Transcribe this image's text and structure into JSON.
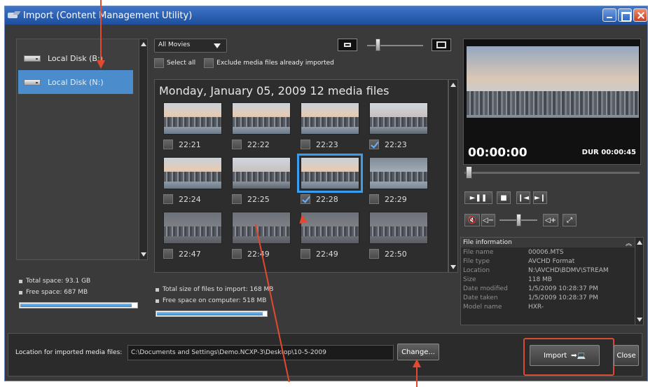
{
  "window": {
    "title": "Import (Content Management Utility)"
  },
  "disks": [
    {
      "label": "Local Disk (B:)"
    },
    {
      "label": "Local Disk (N:)"
    }
  ],
  "left_stats": {
    "total": "Total space: 93.1 GB",
    "free": "Free space: 687 MB",
    "free_fraction": 0.96
  },
  "toolbar": {
    "filter": "All Movies",
    "select_all": "Select all",
    "exclude": "Exclude media files already imported"
  },
  "gallery": {
    "date_header": "Monday, January 05, 2009 12 media files",
    "items": [
      {
        "time": "22:21",
        "checked": false
      },
      {
        "time": "22:22",
        "checked": false
      },
      {
        "time": "22:23",
        "checked": false
      },
      {
        "time": "22:23",
        "checked": true
      },
      {
        "time": "22:24",
        "checked": false
      },
      {
        "time": "22:25",
        "checked": false
      },
      {
        "time": "22:28",
        "checked": true
      },
      {
        "time": "22:29",
        "checked": false
      },
      {
        "time": "22:47",
        "checked": false
      },
      {
        "time": "22:49",
        "checked": false
      },
      {
        "time": "22:49",
        "checked": false
      },
      {
        "time": "22:50",
        "checked": false
      }
    ]
  },
  "mid_stats": {
    "total": "Total size of files to import: 168 MB",
    "free": "Free space on computer: 518 MB",
    "free_fraction": 0.97
  },
  "preview": {
    "time": "00:00:00",
    "duration": "DUR 00:00:45"
  },
  "file_info": {
    "header": "File information",
    "rows": [
      {
        "k": "File name",
        "v": "00006.MTS"
      },
      {
        "k": "File type",
        "v": "AVCHD Format"
      },
      {
        "k": "Location",
        "v": "N:\\AVCHD\\BDMV\\STREAM"
      },
      {
        "k": "Size",
        "v": "118 MB"
      },
      {
        "k": "Date modified",
        "v": "1/5/2009 10:28:37 PM"
      },
      {
        "k": "Date taken",
        "v": "1/5/2009 10:28:37 PM"
      },
      {
        "k": "Model name",
        "v": "HXR-"
      }
    ]
  },
  "bottom": {
    "location_label": "Location for imported media files:",
    "location_value": "C:\\Documents and Settings\\Demo.NCXP-3\\Desktop\\10-5-2009",
    "change": "Change...",
    "import": "Import",
    "close": "Close"
  }
}
